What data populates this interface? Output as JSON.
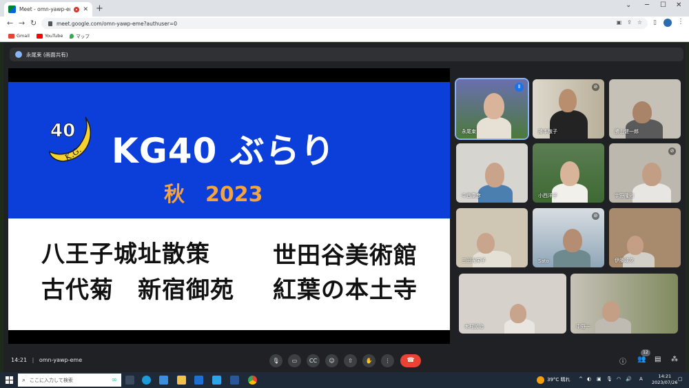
{
  "browser": {
    "tab_title": "Meet - omn-yawp-eme",
    "tab_close": "✕",
    "new_tab": "+",
    "url": "meet.google.com/omn-yawp-eme?authuser=0",
    "bookmarks": [
      "Gmail",
      "YouTube",
      "マップ"
    ]
  },
  "meet": {
    "presenter": "永尾束 (画面共有)",
    "slide": {
      "logo_number": "40",
      "logo_letters": "K.G.",
      "title": "KG40 ぶらり",
      "subtitle": "秋　2023",
      "lines": [
        "八王子城址散策",
        "古代菊　新宿御苑",
        "世田谷美術館",
        "紅葉の本土寺"
      ]
    },
    "participants": [
      {
        "name": "永尾束"
      },
      {
        "name": "藤本敬子"
      },
      {
        "name": "勝山健一郎"
      },
      {
        "name": "中西康彦"
      },
      {
        "name": "小西洋子"
      },
      {
        "name": "宇野隆則"
      },
      {
        "name": "三田光栄子"
      },
      {
        "name": "Sato"
      },
      {
        "name": "伊藤政次"
      },
      {
        "name": "木村民治"
      },
      {
        "name": "中野一"
      }
    ],
    "time": "14:21",
    "meeting_code": "omn-yawp-eme",
    "participant_count": "12"
  },
  "taskbar": {
    "search_placeholder": "ここに入力して検索",
    "weather": "39°C 晴れ",
    "ime": "A",
    "time": "14:21",
    "date": "2023/07/26"
  },
  "colors": {
    "slide_blue": "#0c3fd9",
    "subtitle_orange": "#f3a33f",
    "end_call_red": "#ea4335",
    "speaking_blue": "#1a73e8"
  }
}
